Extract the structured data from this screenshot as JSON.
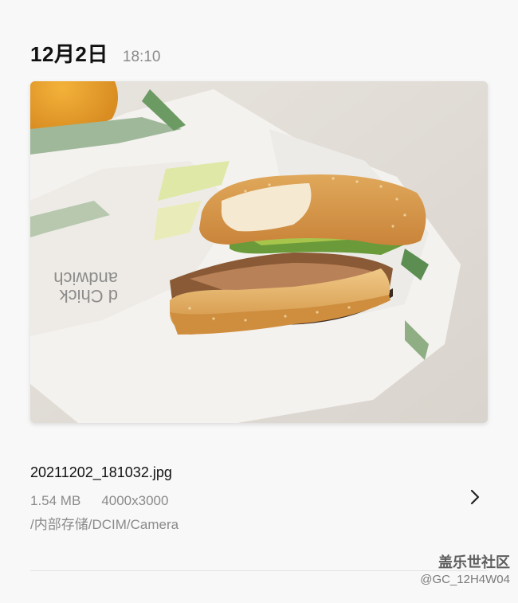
{
  "header": {
    "date": "12月2日",
    "time": "18:10"
  },
  "photo": {
    "subject": "chicken sandwich in paper wrapper",
    "wrapper_print": [
      "d Chick",
      "andwich"
    ],
    "hash_button_label": "#"
  },
  "file": {
    "name": "20211202_181032.jpg",
    "size": "1.54 MB",
    "resolution": "4000x3000",
    "path": "/内部存储/DCIM/Camera"
  },
  "icons": {
    "details": "chevron-right-icon"
  },
  "watermark": {
    "brand": "盖乐世社区",
    "user": "@GC_12H4W04"
  }
}
